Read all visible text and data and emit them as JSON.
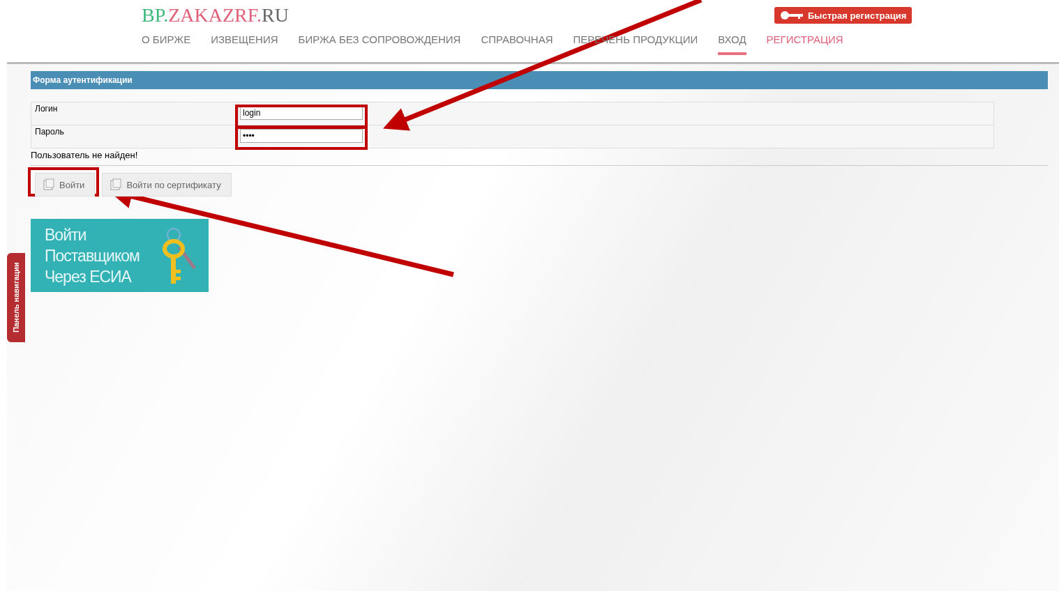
{
  "header": {
    "logo": {
      "part_1": "BP.",
      "part_2": "ZAKAZRF.",
      "part_3": "RU"
    },
    "quick_register": "Быстрая регистрация"
  },
  "nav": [
    {
      "label": "О БИРЖЕ",
      "selected": false,
      "kind": "link"
    },
    {
      "label": "ИЗВЕЩЕНИЯ",
      "selected": false,
      "kind": "link"
    },
    {
      "label": "БИРЖА БЕЗ СОПРОВОЖДЕНИЯ",
      "selected": false,
      "kind": "link"
    },
    {
      "label": "СПРАВОЧНАЯ",
      "selected": false,
      "kind": "link"
    },
    {
      "label": "ПЕРЕЧЕНЬ ПРОДУКЦИИ",
      "selected": false,
      "kind": "link"
    },
    {
      "label": "ВХОД",
      "selected": true,
      "kind": "link"
    },
    {
      "label": "РЕГИСТРАЦИЯ",
      "selected": false,
      "kind": "accent"
    }
  ],
  "form": {
    "title": "Форма аутентификации",
    "fields": [
      {
        "label": "Логин",
        "value": "login"
      },
      {
        "label": "Пароль",
        "value": "••••"
      }
    ],
    "error": "Пользователь не найден!",
    "buttons": [
      "Войти",
      "Войти по сертификату"
    ]
  },
  "esia_banner": [
    "Войти",
    "Поставщиком",
    "Через ЕСИА"
  ],
  "side_tab": "Панель навигации"
}
